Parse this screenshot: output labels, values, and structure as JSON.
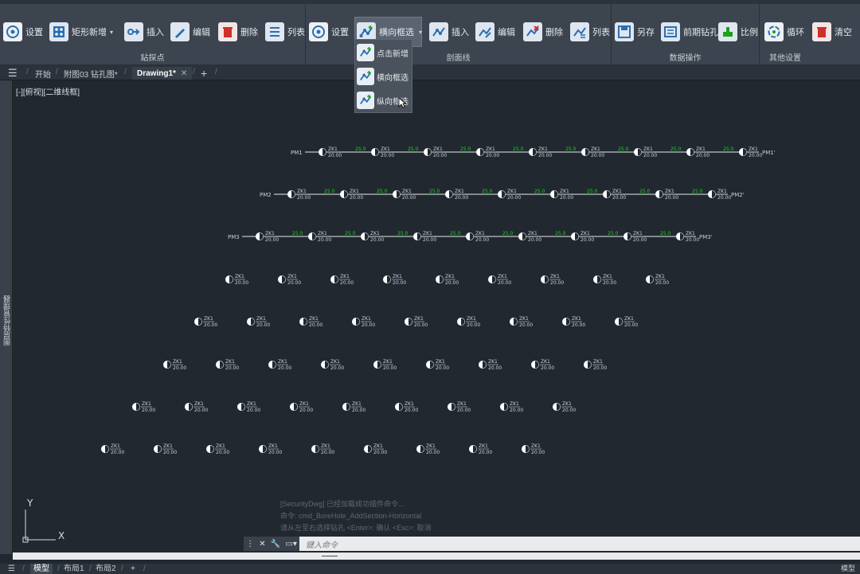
{
  "ribbon": {
    "groups": [
      {
        "label": "鉆探点"
      },
      {
        "label": "剖面线"
      },
      {
        "label": "数据操作"
      },
      {
        "label": "其他设置"
      }
    ],
    "buttons": {
      "settings1": "设置",
      "rect_add": "矩形新增",
      "insert1": "插入",
      "edit1": "编辑",
      "delete1": "删除",
      "list1": "列表",
      "settings2": "设置",
      "horizontal_select": "横向框选",
      "insert2": "插入",
      "edit2": "编辑",
      "delete2": "删除",
      "list2": "列表",
      "save_as": "另存",
      "early_drill": "前期钻孔",
      "scale": "比例",
      "cycle": "循环",
      "clear": "清空"
    },
    "dropdown": {
      "items": [
        "点击新增",
        "横向框选",
        "纵向框选"
      ]
    }
  },
  "tabs": {
    "start": "开始",
    "file1": "附图03 钻孔图*",
    "drawing": "Drawing1*",
    "add": "+"
  },
  "side_panel_label": "图层特性管理器",
  "view_label": "[-][俯视][二维线框]",
  "drawing": {
    "row1": {
      "start": "PM1",
      "end": "PM1'"
    },
    "row2": {
      "start": "PM2",
      "end": "PM2'"
    },
    "row3": {
      "start": "PM3",
      "end": "PM3'"
    },
    "node_top": "ZK1",
    "node_bottom": "20.00",
    "gap_label": "25.0"
  },
  "ucs": {
    "x": "X",
    "y": "Y"
  },
  "command": {
    "history": [
      "[SecurityDwg] 已经加载成功插件命令...",
      "命令: cmd_BoreHole_AddSection-Horizontal",
      "请从左至右选择钻孔 <Enter>: 确认 <Esc>: 取消"
    ],
    "placeholder": "键入命令"
  },
  "bottom_tabs": {
    "model": "模型",
    "layout1": "布局1",
    "layout2": "布局2",
    "add": "+"
  },
  "status_right": "模型"
}
